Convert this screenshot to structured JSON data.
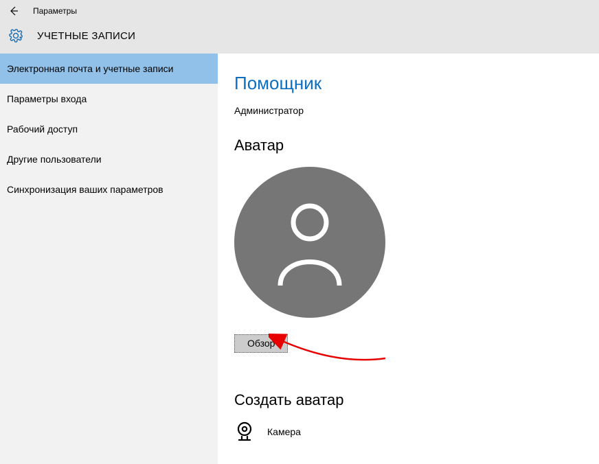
{
  "titlebar": {
    "app_title": "Параметры"
  },
  "header": {
    "section_title": "УЧЕТНЫЕ ЗАПИСИ"
  },
  "sidebar": {
    "items": [
      {
        "label": "Электронная почта и учетные записи",
        "selected": true
      },
      {
        "label": "Параметры входа",
        "selected": false
      },
      {
        "label": "Рабочий доступ",
        "selected": false
      },
      {
        "label": "Другие пользователи",
        "selected": false
      },
      {
        "label": "Синхронизация ваших параметров",
        "selected": false
      }
    ]
  },
  "content": {
    "user_name": "Помощник",
    "user_role": "Администратор",
    "avatar_heading": "Аватар",
    "browse_button": "Обзор",
    "create_heading": "Создать аватар",
    "camera_label": "Камера"
  },
  "colors": {
    "accent": "#0b6fc2",
    "sidebar_selected": "#91c0e8",
    "avatar_bg": "#767676",
    "annotation": "#e60000"
  }
}
